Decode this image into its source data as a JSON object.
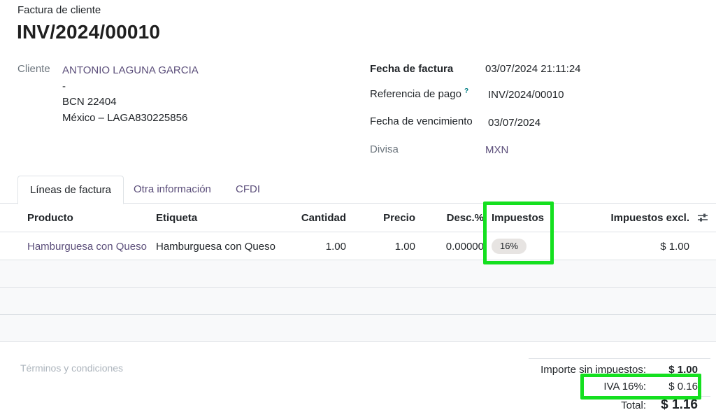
{
  "header": {
    "doc_type": "Factura de cliente",
    "invoice_number": "INV/2024/00010"
  },
  "customer": {
    "label": "Cliente",
    "name": "ANTONIO LAGUNA GARCIA",
    "line2": "-",
    "line3": "BCN 22404",
    "line4": "México – LAGA830225856"
  },
  "info": {
    "invoice_date_label": "Fecha de factura",
    "invoice_date": "03/07/2024 21:11:24",
    "payment_ref_label": "Referencia de pago",
    "payment_ref_help": "?",
    "payment_ref": "INV/2024/00010",
    "due_date_label": "Fecha de vencimiento",
    "due_date": "03/07/2024",
    "currency_label": "Divisa",
    "currency": "MXN"
  },
  "tabs": [
    "Líneas de factura",
    "Otra información",
    "CFDI"
  ],
  "table": {
    "columns": {
      "product": "Producto",
      "label": "Etiqueta",
      "quantity": "Cantidad",
      "price": "Precio",
      "discount": "Desc.%",
      "taxes": "Impuestos",
      "subtotal": "Impuestos excl."
    },
    "rows": [
      {
        "product": "Hamburguesa con Queso",
        "label": "Hamburguesa con Queso",
        "quantity": "1.00",
        "price": "1.00",
        "discount": "0.00000",
        "tax": "16%",
        "subtotal": "$ 1.00"
      }
    ]
  },
  "terms_placeholder": "Términos y condiciones",
  "totals": {
    "untaxed_label": "Importe sin impuestos:",
    "untaxed": "$ 1.00",
    "tax_label": "IVA 16%:",
    "tax": "$ 0.16",
    "total_label": "Total:",
    "total": "$ 1.16"
  },
  "colors": {
    "link": "#5b4e7a",
    "highlight": "#14e01f",
    "badge": "#e7e4e2"
  },
  "icons": {
    "column_settings": "sliders-icon"
  }
}
